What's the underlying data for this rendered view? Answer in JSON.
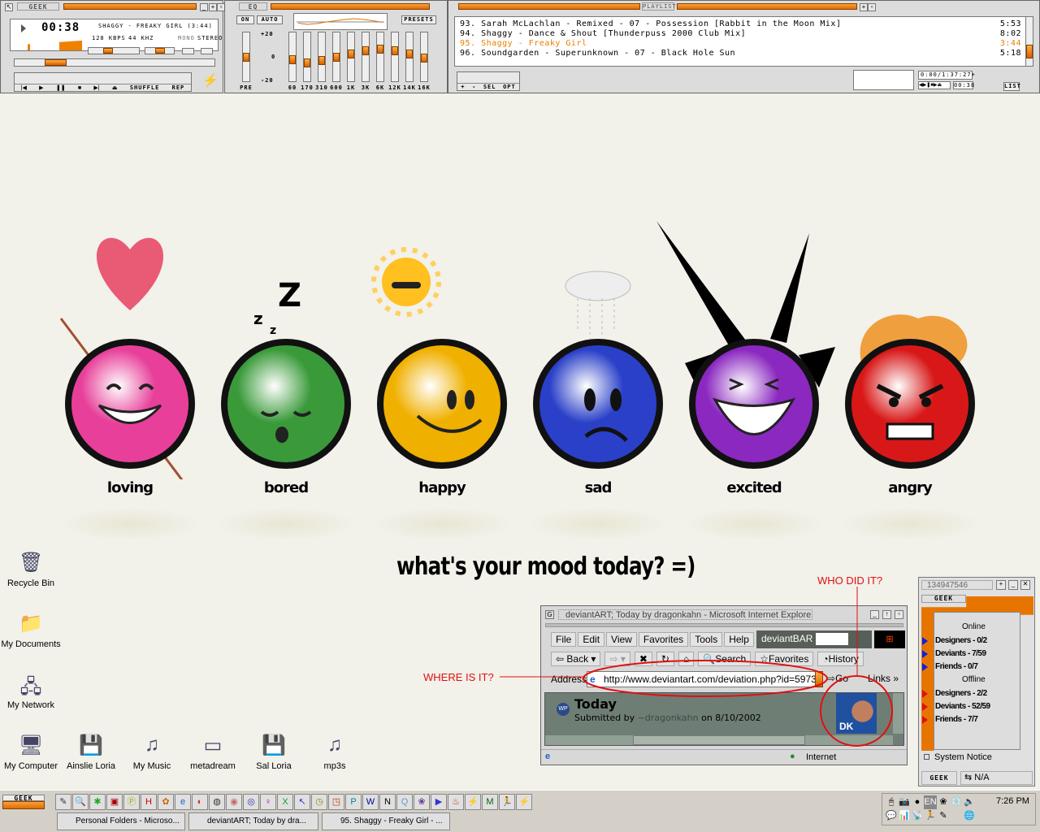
{
  "winamp": {
    "title": "GEEK",
    "time": "00:38",
    "song": "SHAGGY - FREAKY GIRL (3:44)",
    "bitrate": "128 KBPS",
    "samplerate": "44 KHZ",
    "mono": "MONO",
    "stereo": "STEREO",
    "seek_progress": 0.17,
    "volume": 0.35,
    "balance": 0.5,
    "controls": [
      "|◀",
      "▶",
      "❚❚",
      "■",
      "▶|",
      "⏏"
    ],
    "shuffle": "SHUFFLE",
    "repeat": "REP"
  },
  "eq": {
    "title": "EQ",
    "on": "ON",
    "auto": "AUTO",
    "presets": "PRESETS",
    "scale": [
      "+20",
      "0",
      "-20"
    ],
    "preamp_label": "PRE",
    "preamp_db": 0,
    "bands": [
      {
        "label": "60",
        "db": -3
      },
      {
        "label": "170",
        "db": -6
      },
      {
        "label": "310",
        "db": -4
      },
      {
        "label": "600",
        "db": 0
      },
      {
        "label": "1K",
        "db": 3
      },
      {
        "label": "3K",
        "db": 6
      },
      {
        "label": "6K",
        "db": 8
      },
      {
        "label": "12K",
        "db": 6
      },
      {
        "label": "14K",
        "db": 3
      },
      {
        "label": "16K",
        "db": -1
      }
    ]
  },
  "playlist": {
    "title": "PLAYLIST",
    "items": [
      {
        "name": "93. Sarah McLachlan - Remixed - 07 - Possession [Rabbit in the Moon Mix]",
        "time": "5:53"
      },
      {
        "name": "94. Shaggy - Dance & Shout [Thunderpuss 2000 Club Mix]",
        "time": "8:02"
      },
      {
        "name": "95. Shaggy - Freaky Girl",
        "time": "3:44",
        "current": true
      },
      {
        "name": "96. Soundgarden - Superunknown - 07 - Black Hole Sun",
        "time": "5:18"
      }
    ],
    "buttons": [
      "+",
      "-",
      "SEL",
      "OPT"
    ],
    "total": "0:00/1:37:27+",
    "mini_time": "00:38",
    "list": "LIST"
  },
  "moods": [
    {
      "label": "loving",
      "color": "#e8409a"
    },
    {
      "label": "bored",
      "color": "#3a9a3a"
    },
    {
      "label": "happy",
      "color": "#f0b000"
    },
    {
      "label": "sad",
      "color": "#2a40c8"
    },
    {
      "label": "excited",
      "color": "#8a28c0"
    },
    {
      "label": "angry",
      "color": "#d81818"
    }
  ],
  "tagline": "what's your mood today? =)",
  "desktop_icons": [
    "Recycle Bin",
    "My Documents",
    "My Network",
    "My Computer",
    "Ainslie Loria",
    "My Music",
    "metadream",
    "Sal Loria",
    "mp3s"
  ],
  "annotations": {
    "who": "WHO DID IT?",
    "where": "WHERE IS IT?"
  },
  "ie": {
    "title": "deviantART; Today by dragonkahn - Microsoft Internet Explorer",
    "menus": [
      "File",
      "Edit",
      "View",
      "Favorites",
      "Tools",
      "Help"
    ],
    "deviantbar": "deviantBAR",
    "back": "Back",
    "search": "Search",
    "favorites": "Favorites",
    "history": "History",
    "address_label": "Address",
    "url": "http://www.deviantart.com/deviation.php?id=597304",
    "go": "Go",
    "links": "Links",
    "page_title": "Today",
    "submitted_prefix": "Submitted by ",
    "author": "~dragonkahn",
    "submitted_suffix": " on 8/10/2002",
    "avatar_text": "DK",
    "zone": "Internet"
  },
  "buddy": {
    "id": "134947546",
    "skin": "GEEK",
    "online": "Online",
    "online_groups": [
      "Designers - 0/2",
      "Deviants - 7/59",
      "Friends - 0/7"
    ],
    "offline": "Offline",
    "offline_groups": [
      "Designers - 2/2",
      "Deviants - 52/59",
      "Friends - 7/7"
    ],
    "system_notice": "System Notice",
    "status": "N/A"
  },
  "taskbar": {
    "start": "GEEK",
    "tasks": [
      "Personal Folders - Microso...",
      "deviantART; Today by dra...",
      "95. Shaggy - Freaky Girl - ..."
    ],
    "tray_lang": "EN",
    "clock": "7:26 PM"
  }
}
